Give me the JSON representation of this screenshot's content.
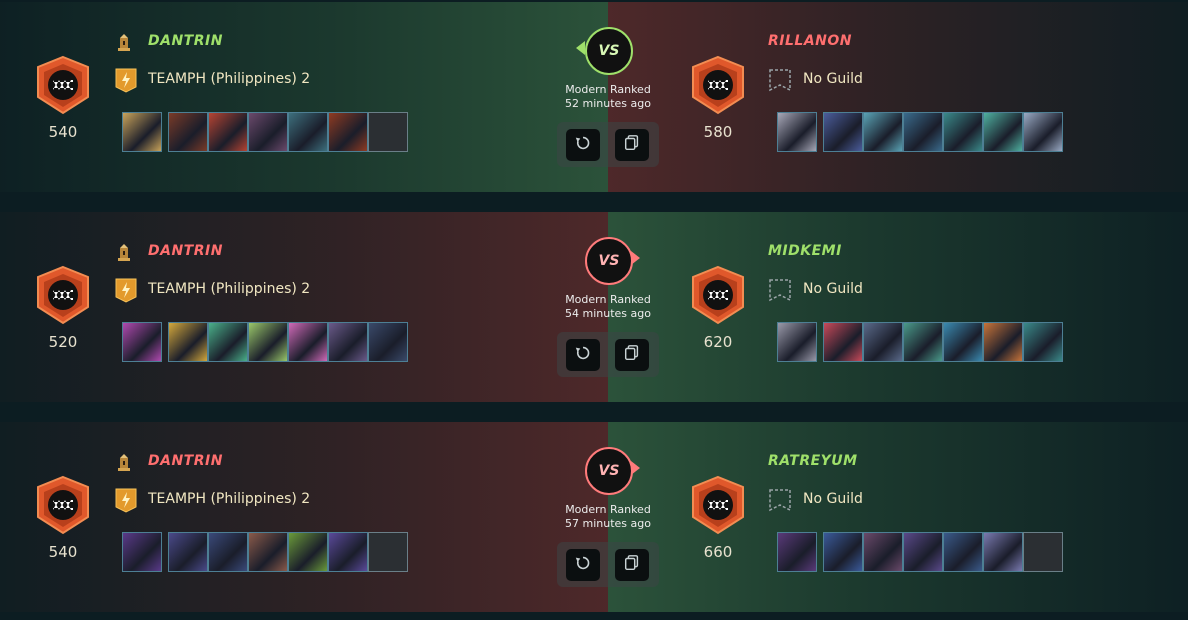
{
  "battles": [
    {
      "result": "win",
      "vs_label": "VS",
      "mode": "Modern Ranked",
      "time_ago": "52 minutes ago",
      "left": {
        "name": "DANTRIN",
        "guild": "TEAMPH (Philippines) 2",
        "rating": "540"
      },
      "right": {
        "name": "RILLANON",
        "guild": "No Guild",
        "rating": "580"
      },
      "left_team": [
        "#c9a35a",
        "#7a3b28",
        "#b64433",
        "#6b4a6c",
        "#3d6f7d",
        "#8f3b22",
        "empty"
      ],
      "right_team": [
        "#a8a8b8",
        "#4b5d9c",
        "#5aa3b5",
        "#3a6b8c",
        "#3a8a8a",
        "#4fb0a0",
        "#9aaac4"
      ]
    },
    {
      "result": "loss",
      "vs_label": "VS",
      "mode": "Modern Ranked",
      "time_ago": "54 minutes ago",
      "left": {
        "name": "DANTRIN",
        "guild": "TEAMPH (Philippines) 2",
        "rating": "520"
      },
      "right": {
        "name": "MIDKEMI",
        "guild": "No Guild",
        "rating": "620"
      },
      "left_team": [
        "#b04ab0",
        "#d4a83c",
        "#4ab08a",
        "#9ac86a",
        "#d06ab8",
        "#6a5a8a",
        "#3a4a6a"
      ],
      "right_team": [
        "#9a9aaa",
        "#c84a5a",
        "#5a6a8a",
        "#4a9a8a",
        "#3a8ab0",
        "#c8743a",
        "#3a8a8a"
      ]
    },
    {
      "result": "loss",
      "vs_label": "VS",
      "mode": "Modern Ranked",
      "time_ago": "57 minutes ago",
      "left": {
        "name": "DANTRIN",
        "guild": "TEAMPH (Philippines) 2",
        "rating": "540"
      },
      "right": {
        "name": "RATREYUM",
        "guild": "No Guild",
        "rating": "660"
      },
      "left_team": [
        "#5a3a8a",
        "#4a4a8a",
        "#3a4a7a",
        "#8a5a4a",
        "#6a9a3a",
        "#5a4a9a",
        "empty"
      ],
      "right_team": [
        "#5a3a7a",
        "#3a5a9a",
        "#6a4a6a",
        "#5a4a8a",
        "#3a5a8a",
        "#7a7ab0",
        "empty"
      ]
    }
  ],
  "colors": {
    "win_accent": "#9fe06a",
    "loss_accent": "#ff6f6f",
    "badge": "#e0582b"
  },
  "icons": {
    "rank": "tower-icon",
    "guild": "lightning-banner-icon",
    "no_guild": "dashed-banner-icon",
    "badge": "fanged-mouth-icon",
    "replay": "replay-icon",
    "copy": "copy-icon"
  }
}
